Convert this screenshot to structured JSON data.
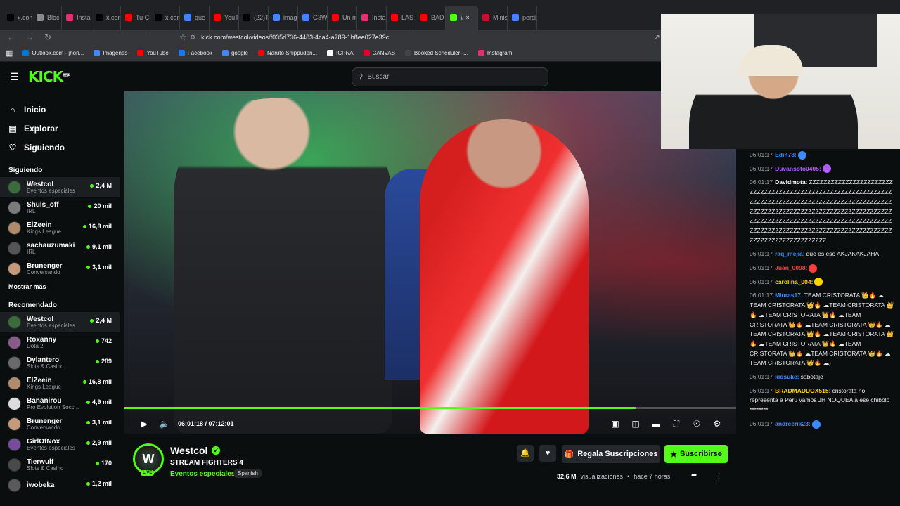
{
  "browser": {
    "tabs": [
      {
        "label": "x.com",
        "color": "#000000",
        "icon": "x-icon"
      },
      {
        "label": "Bloc",
        "color": "#8a8a8a",
        "icon": "doc-icon"
      },
      {
        "label": "Insta",
        "color": "#e1306c",
        "icon": "instagram-icon"
      },
      {
        "label": "x.con",
        "color": "#000000",
        "icon": "x-icon"
      },
      {
        "label": "Tu C",
        "color": "#ff0000",
        "icon": "youtube-icon"
      },
      {
        "label": "x.con",
        "color": "#000000",
        "icon": "x-icon"
      },
      {
        "label": "que",
        "color": "#4285f4",
        "icon": "google-icon"
      },
      {
        "label": "YouT",
        "color": "#ff0000",
        "icon": "youtube-icon"
      },
      {
        "label": "(22)T",
        "color": "#000000",
        "icon": "tiktok-icon"
      },
      {
        "label": "imag",
        "color": "#4285f4",
        "icon": "google-icon"
      },
      {
        "label": "G3W",
        "color": "#4285f4",
        "icon": "google-icon"
      },
      {
        "label": "Un m",
        "color": "#ff0000",
        "icon": "youtube-icon"
      },
      {
        "label": "Insta",
        "color": "#e1306c",
        "icon": "instagram-icon"
      },
      {
        "label": "LAS",
        "color": "#ff0000",
        "icon": "youtube-icon"
      },
      {
        "label": "BAD",
        "color": "#ff0000",
        "icon": "youtube-icon"
      },
      {
        "label": "\\",
        "color": "#53fc18",
        "icon": "kick-icon",
        "active": true
      },
      {
        "label": "Minis",
        "color": "#c8102e",
        "icon": "flag-icon"
      },
      {
        "label": "perdi",
        "color": "#4285f4",
        "icon": "google-icon"
      }
    ],
    "url": "kick.com/westcol/videos/f035d736-4483-4ca4-a789-1b8ee027e39c",
    "bookmarks": [
      {
        "label": "Outlook.com - jhon...",
        "color": "#0078d4"
      },
      {
        "label": "Imágenes",
        "color": "#4285f4"
      },
      {
        "label": "YouTube",
        "color": "#ff0000"
      },
      {
        "label": "Facebook",
        "color": "#1877f2"
      },
      {
        "label": "google",
        "color": "#4285f4"
      },
      {
        "label": "Naruto Shippuden...",
        "color": "#ff0000"
      },
      {
        "label": "ICPNA",
        "color": "#ffffff"
      },
      {
        "label": "CANVAS",
        "color": "#e4002b"
      },
      {
        "label": "Booked Scheduler -...",
        "color": "#444444"
      },
      {
        "label": "Instagram",
        "color": "#e1306c"
      }
    ]
  },
  "kick": {
    "logo": "KICK",
    "logo_sup": "BETA",
    "search_placeholder": "Buscar",
    "accent": "#53fc18"
  },
  "sidebar": {
    "nav": [
      {
        "label": "Inicio",
        "icon": "home-icon"
      },
      {
        "label": "Explorar",
        "icon": "compass-icon"
      },
      {
        "label": "Siguiendo",
        "icon": "heart-icon"
      }
    ],
    "following_title": "Siguiendo",
    "following": [
      {
        "name": "Westcol",
        "category": "Eventos especiales",
        "viewers": "2,4 M",
        "color": "#3a6b3a",
        "selected": true
      },
      {
        "name": "Shuls_off",
        "category": "IRL",
        "viewers": "20 mil",
        "color": "#7a7a7a"
      },
      {
        "name": "ElZeein",
        "category": "Kings League",
        "viewers": "16,8 mil",
        "color": "#b08a6a"
      },
      {
        "name": "sachauzumaki",
        "category": "IRL",
        "viewers": "9,1 mil",
        "color": "#555555"
      },
      {
        "name": "Brunenger",
        "category": "Conversando",
        "viewers": "3,1 mil",
        "color": "#c49a7a"
      }
    ],
    "more_label": "Mostrar más",
    "recommended_title": "Recomendado",
    "recommended": [
      {
        "name": "Westcol",
        "category": "Eventos especiales",
        "viewers": "2,4 M",
        "color": "#3a6b3a",
        "selected": true
      },
      {
        "name": "Roxanny",
        "category": "Dota 2",
        "viewers": "742",
        "color": "#8a5a8a"
      },
      {
        "name": "Dylantero",
        "category": "Slots & Casino",
        "viewers": "289",
        "color": "#6a6a6a"
      },
      {
        "name": "ElZeein",
        "category": "Kings League",
        "viewers": "16,8 mil",
        "color": "#b08a6a"
      },
      {
        "name": "Bananirou",
        "category": "Pro Evolution Socc...",
        "viewers": "4,9 mil",
        "color": "#dddddd"
      },
      {
        "name": "Brunenger",
        "category": "Conversando",
        "viewers": "3,1 mil",
        "color": "#c49a7a"
      },
      {
        "name": "GirlOfNox",
        "category": "Eventos especiales",
        "viewers": "2,9 mil",
        "color": "#7a4aa0"
      },
      {
        "name": "Tierwulf",
        "category": "Slots & Casino",
        "viewers": "170",
        "color": "#4a4a4a"
      },
      {
        "name": "iwobeka",
        "category": "",
        "viewers": "1,2 mil",
        "color": "#5a5a5a"
      }
    ]
  },
  "player": {
    "time": "06:01:18 / 07:12:01",
    "progress_fraction": 0.8346,
    "buffer_fraction": 0.837
  },
  "stream": {
    "channel": "Westcol",
    "avatar_letter": "W",
    "live": "LIVE",
    "title": "STREAM FIGHTERS 4",
    "category": "Eventos especiales",
    "language": "Spanish",
    "gift_label": "Regala Suscripciones",
    "subscribe_label": "Suscribirse",
    "views": "32,6 M",
    "views_label": "visualizaciones",
    "dot": "•",
    "ago": "hace 7 horas"
  },
  "chat": [
    {
      "ts": "06:01:17",
      "user": "Edin78:",
      "color": "#3d8bff",
      "text": ""
    },
    {
      "ts": "06:01:17",
      "user": "Duvansoto0405:",
      "color": "#b15cff",
      "text": ""
    },
    {
      "ts": "06:01:17",
      "user": "Davidmota:",
      "color": "#ffffff",
      "text": "ZZZZZZZZZZZZZZZZZZZZZZZZZZZZZZZZZZZZZZZZZZZZZZZZZZZZZZZZZZZZZZZZZZZZZZZZZZZZZZZZZZZZZZZZZZZZZZZZZZZZZZZZZZZZZZZZZZZZZZZZZZZZZZZZZZZZZZZZZZZZZZZZZZZZZZZZZZZZZZZZZZZZZZZZZZZZZZZZZZZZZZZZZZZZZZZZZZZZZZZZZZZZZZZZZZZZZZZZZZZZZZZZZZZZZZZZZZZZZZZ"
    },
    {
      "ts": "06:01:17",
      "user": "raq_mejia:",
      "color": "#3d8bff",
      "text": "que es eso AKJAKAKJAHA"
    },
    {
      "ts": "06:01:17",
      "user": "Juan_0098:",
      "color": "#ff3b3b",
      "text": ""
    },
    {
      "ts": "06:01:17",
      "user": "carolina_004:",
      "color": "#ffd400",
      "text": ""
    },
    {
      "ts": "06:01:17",
      "user": "Miuras17:",
      "color": "#3d8bff",
      "text": "TEAM CRISTORATA 👑🔥 ☁TEAM CRISTORATA 👑🔥 ☁TEAM CRISTORATA 👑🔥 ☁TEAM CRISTORATA 👑🔥 ☁TEAM CRISTORATA 👑🔥 ☁TEAM CRISTORATA 👑🔥 ☁TEAM CRISTORATA 👑🔥 ☁TEAM CRISTORATA 👑🔥 ☁TEAM CRISTORATA 👑🔥 ☁TEAM CRISTORATA 👑🔥 ☁TEAM CRISTORATA 👑🔥 ☁TEAM CRISTORATA 👑🔥 ☁}"
    },
    {
      "ts": "06:01:17",
      "user": "kiosuke:",
      "color": "#3d8bff",
      "text": "sabotaje"
    },
    {
      "ts": "06:01:17",
      "user": "BRADMADDOX515:",
      "color": "#ffd400",
      "text": "cristorata no representa a Perú vamos JH NOQUEA a ese chibolo ********"
    },
    {
      "ts": "06:01:17",
      "user": "andreerik23:",
      "color": "#3d8bff",
      "text": ""
    }
  ]
}
